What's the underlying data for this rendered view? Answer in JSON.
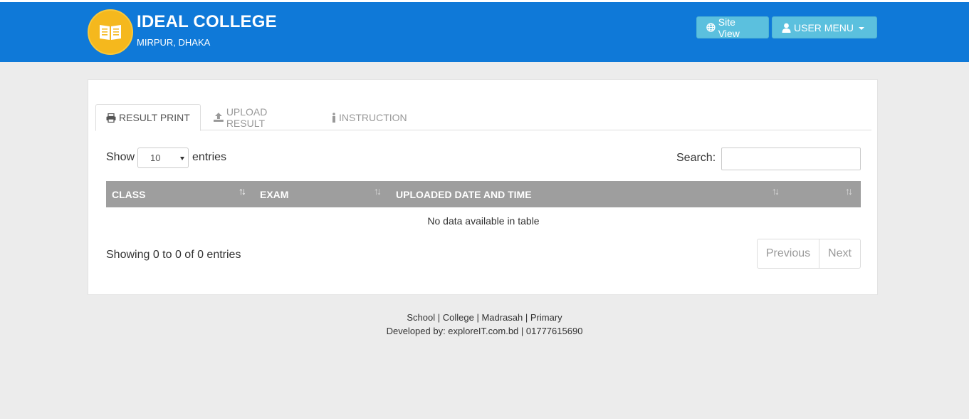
{
  "header": {
    "title": "IDEAL COLLEGE",
    "subtitle": "MIRPUR, DHAKA",
    "logo_icon": "book-icon",
    "site_view_label": "Site View",
    "user_menu_label": "USER MENU",
    "brand_color": "#0f79d8",
    "button_color": "#5bc0de"
  },
  "tabs": [
    {
      "label": "RESULT PRINT",
      "icon": "printer-icon",
      "active": true
    },
    {
      "label": "UPLOAD RESULT",
      "icon": "upload-icon",
      "active": false
    },
    {
      "label": "INSTRUCTION",
      "icon": "info-icon",
      "active": false
    }
  ],
  "table_controls": {
    "show_label": "Show",
    "page_length": "10",
    "entries_label": "entries",
    "search_label": "Search:",
    "search_value": ""
  },
  "table": {
    "columns": [
      "CLASS",
      "EXAM",
      "UPLOADED DATE AND TIME",
      ""
    ],
    "empty_message": "No data available in table",
    "info": "Showing 0 to 0 of 0 entries",
    "header_color": "#9e9e9e"
  },
  "pagination": {
    "previous_label": "Previous",
    "next_label": "Next"
  },
  "footer": {
    "links": [
      "School",
      "College",
      "Madrasah",
      "Primary"
    ],
    "developer_line": "Developed by: exploreIT.com.bd | 01777615690"
  }
}
